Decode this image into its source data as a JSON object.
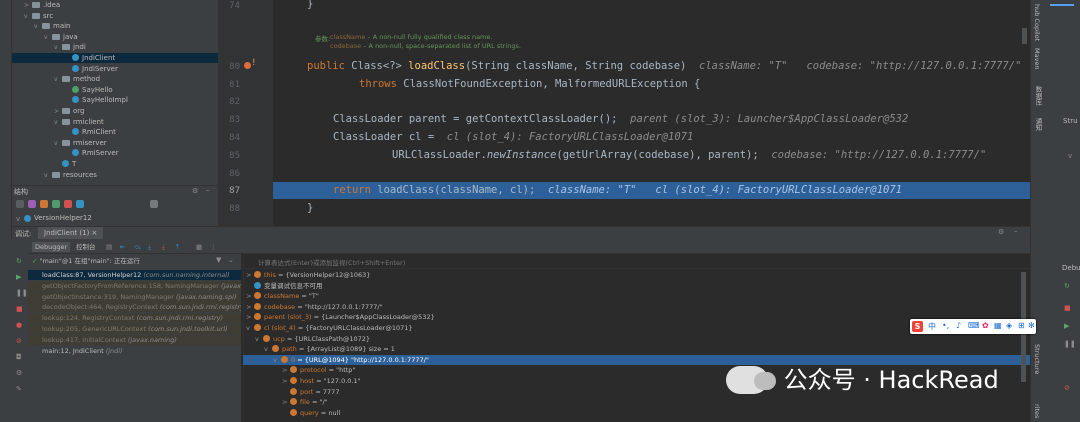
{
  "tree": {
    "items": [
      {
        "label": ".idea",
        "depth": 1,
        "kind": "folder"
      },
      {
        "label": "src",
        "depth": 1,
        "kind": "folder"
      },
      {
        "label": "main",
        "depth": 2,
        "kind": "folder"
      },
      {
        "label": "java",
        "depth": 3,
        "kind": "folder"
      },
      {
        "label": "jndi",
        "depth": 4,
        "kind": "folder"
      },
      {
        "label": "JndiClient",
        "depth": 5,
        "kind": "class",
        "selected": true
      },
      {
        "label": "JndiServer",
        "depth": 5,
        "kind": "class"
      },
      {
        "label": "method",
        "depth": 4,
        "kind": "folder"
      },
      {
        "label": "SayHello",
        "depth": 5,
        "kind": "iface"
      },
      {
        "label": "SayHelloImpl",
        "depth": 5,
        "kind": "class"
      },
      {
        "label": "org",
        "depth": 4,
        "kind": "folder"
      },
      {
        "label": "rmiclient",
        "depth": 4,
        "kind": "folder"
      },
      {
        "label": "RmiClient",
        "depth": 5,
        "kind": "class"
      },
      {
        "label": "rmiserver",
        "depth": 4,
        "kind": "folder"
      },
      {
        "label": "RmiServer",
        "depth": 5,
        "kind": "class"
      },
      {
        "label": "T",
        "depth": 4,
        "kind": "class"
      },
      {
        "label": "resources",
        "depth": 3,
        "kind": "folder"
      }
    ]
  },
  "structure": {
    "title": "结构",
    "item": "VersionHelper12"
  },
  "editor": {
    "line_numbers": [
      "74",
      "80",
      "81",
      "82",
      "83",
      "84",
      "85",
      "86",
      "87",
      "88"
    ],
    "doc": {
      "p1_name": "className",
      "p1_desc": " – A non-null fully qualified class name.",
      "p2_name": "codebase",
      "p2_desc": " – A non-null, space-separated list of URL strings."
    },
    "l80": {
      "kw": "public ",
      "t1": "Class<?> ",
      "fn": "loadClass",
      "t2": "(String className, String codebase)",
      "hint": "className: \"T\"   codebase: \"http://127.0.0.1:7777/\""
    },
    "l81": {
      "kw": "throws ",
      "t1": "ClassNotFoundException, MalformedURLException {"
    },
    "l83": {
      "t1": "ClassLoader parent = getContextClassLoader();",
      "hint": "parent (slot_3): Launcher$AppClassLoader@532"
    },
    "l84": {
      "t1": "ClassLoader cl = ",
      "hint": "cl (slot_4): FactoryURLClassLoader@1071"
    },
    "l85": {
      "t1": "URLClassLoader.",
      "it": "newInstance",
      "t2": "(getUrlArray(codebase), parent);",
      "hint": "codebase: \"http://127.0.0.1:7777/\""
    },
    "l87": {
      "kw": "return ",
      "t1": "loadClass(className, cl);",
      "hint": "className: \"T\"   cl (slot_4): FactoryURLClassLoader@1071"
    },
    "l88": {
      "t1": "}"
    },
    "l74": {
      "t1": "}"
    }
  },
  "debug": {
    "title": "调试:",
    "session_tab": "JndiClient (1)",
    "tab_debugger": "Debugger",
    "tab_console": "控制台",
    "thread": "\"main\"@1 在组\"main\": 正在运行",
    "eval_placeholder": "计算表达式(Enter)或添加监视(Ctrl+Shift+Enter)",
    "frames": [
      {
        "text": "loadClass:87, VersionHelper12",
        "pkg": "(com.sun.naming.internal)",
        "state": "sel"
      },
      {
        "text": "getObjectFactoryFromReference:158, NamingManager",
        "pkg": "(javax.nam",
        "state": "dim"
      },
      {
        "text": "getObjectInstance:319, NamingManager",
        "pkg": "(javax.naming.spi)",
        "state": "dim"
      },
      {
        "text": "decodeObject:464, RegistryContext",
        "pkg": "(com.sun.jndi.rmi.registry)",
        "state": "dim"
      },
      {
        "text": "lookup:124, RegistryContext",
        "pkg": "(com.sun.jndi.rmi.registry)",
        "state": "dim"
      },
      {
        "text": "lookup:205, GenericURLContext",
        "pkg": "(com.sun.jndi.toolkit.url)",
        "state": "dim"
      },
      {
        "text": "lookup:417, InitialContext",
        "pkg": "(javax.naming)",
        "state": "dim"
      },
      {
        "text": "main:12, JndiClient",
        "pkg": "(jndi)",
        "state": "normal"
      }
    ],
    "vars": [
      {
        "name": "this",
        "value": " = {VersionHelper12@1063}",
        "depth": 0,
        "expand": ">"
      },
      {
        "name": "",
        "value": "变量调试信息不可用",
        "depth": 0,
        "expand": "",
        "info": true
      },
      {
        "name": "className",
        "value": " = \"T\"",
        "depth": 0,
        "expand": ">"
      },
      {
        "name": "codebase",
        "value": " = \"http://127.0.0.1:7777/\"",
        "depth": 0,
        "expand": ">"
      },
      {
        "name": "parent (slot_3)",
        "value": " = {Launcher$AppClassLoader@532}",
        "depth": 0,
        "expand": ">"
      },
      {
        "name": "cl (slot_4)",
        "value": " = {FactoryURLClassLoader@1071}",
        "depth": 0,
        "expand": "v"
      },
      {
        "name": "ucp",
        "value": " = {URLClassPath@1072}",
        "depth": 1,
        "expand": "v"
      },
      {
        "name": "path",
        "value": " = {ArrayList@1089}  size = 1",
        "depth": 2,
        "expand": "v"
      },
      {
        "name": "0",
        "value": " = {URL@1094} \"http://127.0.0.1:7777/\"",
        "depth": 3,
        "expand": "v",
        "selected": true
      },
      {
        "name": "protocol",
        "value": " = \"http\"",
        "depth": 4,
        "expand": ">"
      },
      {
        "name": "host",
        "value": " = \"127.0.0.1\"",
        "depth": 4,
        "expand": ">"
      },
      {
        "name": "port",
        "value": " = 7777",
        "depth": 4,
        "expand": ""
      },
      {
        "name": "file",
        "value": " = \"/\"",
        "depth": 4,
        "expand": ">"
      },
      {
        "name": "query",
        "value": " = null",
        "depth": 4,
        "expand": ""
      }
    ]
  },
  "right": {
    "strip_labels": [
      "hub Copilot",
      "Maven",
      "数据库",
      "通知"
    ],
    "panel_top": "Stru",
    "panel_debug": "Debu",
    "structure_tab": "Structure",
    "favorites_tab": "rites"
  },
  "watermark": {
    "text": "公众号 · HackRead"
  },
  "ime": {
    "logo": "S",
    "label": "中"
  },
  "colors": {
    "selection": "#2d6099",
    "keyword": "#cc7832",
    "function": "#ffc66d",
    "string": "#6a8759"
  }
}
